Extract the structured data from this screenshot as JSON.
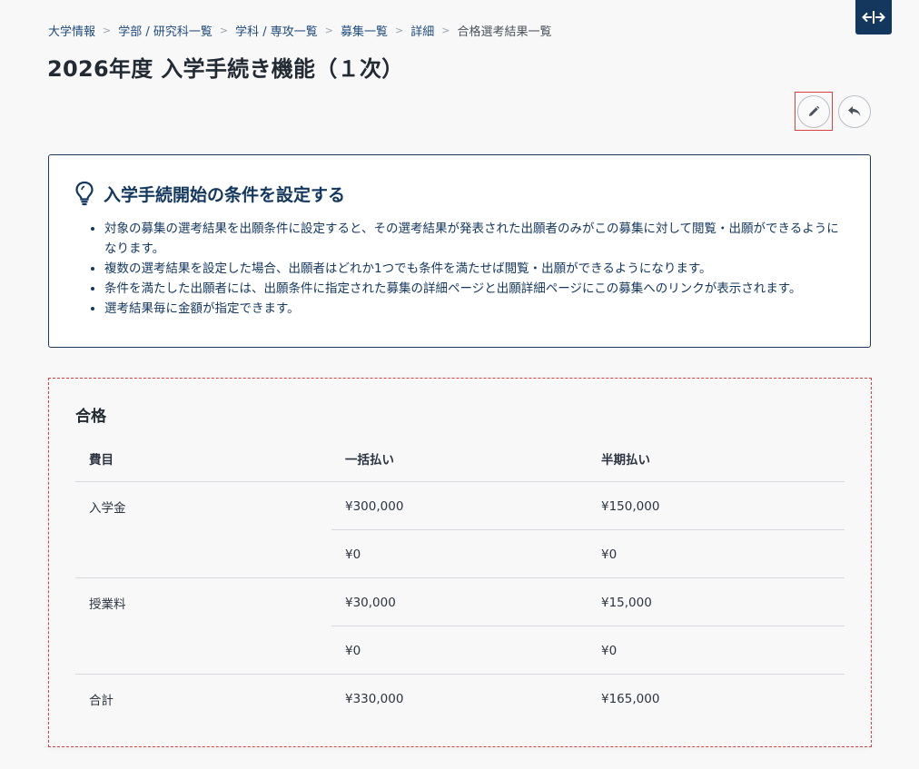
{
  "breadcrumb": [
    {
      "label": "大学情報"
    },
    {
      "label": "学部 / 研究科一覧"
    },
    {
      "label": "学科 / 専攻一覧"
    },
    {
      "label": "募集一覧"
    },
    {
      "label": "詳細"
    }
  ],
  "breadcrumb_current": "合格選考結果一覧",
  "page_title": "2026年度 入学手続き機能（１次）",
  "info": {
    "icon": "lightbulb-icon",
    "title": "入学手続開始の条件を設定する",
    "items": [
      "対象の募集の選考結果を出願条件に設定すると、その選考結果が発表された出願者のみがこの募集に対して閲覧・出願ができるようになります。",
      "複数の選考結果を設定した場合、出願者はどれか1つでも条件を満たせば閲覧・出願ができるようになります。",
      "条件を満たした出願者には、出願条件に指定された募集の詳細ページと出願詳細ページにこの募集へのリンクが表示されます。",
      "選考結果毎に金額が指定できます。"
    ]
  },
  "result": {
    "title": "合格",
    "headers": [
      "費目",
      "一括払い",
      "半期払い"
    ],
    "rows": [
      {
        "item": "入学金",
        "lump": "¥300,000",
        "half": "¥150,000"
      },
      {
        "item": "",
        "lump": "¥0",
        "half": "¥0"
      },
      {
        "item": "授業料",
        "lump": "¥30,000",
        "half": "¥15,000"
      },
      {
        "item": "",
        "lump": "¥0",
        "half": "¥0"
      },
      {
        "item": "合計",
        "lump": "¥330,000",
        "half": "¥165,000"
      }
    ]
  },
  "colors": {
    "navy": "#14375e",
    "highlight_red": "#d94141"
  }
}
